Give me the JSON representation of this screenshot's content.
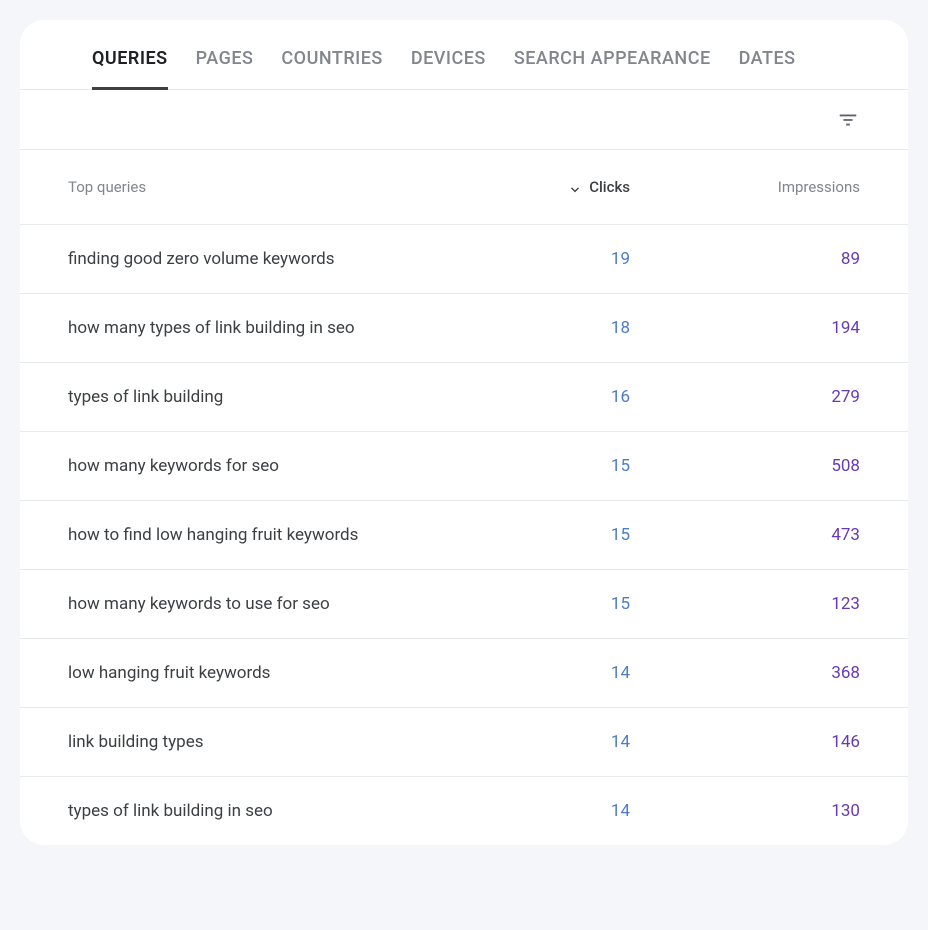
{
  "tabs": [
    {
      "label": "QUERIES",
      "active": true
    },
    {
      "label": "PAGES",
      "active": false
    },
    {
      "label": "COUNTRIES",
      "active": false
    },
    {
      "label": "DEVICES",
      "active": false
    },
    {
      "label": "SEARCH APPEARANCE",
      "active": false
    },
    {
      "label": "DATES",
      "active": false
    }
  ],
  "columns": {
    "query": "Top queries",
    "clicks": "Clicks",
    "impressions": "Impressions"
  },
  "sort": {
    "column": "clicks",
    "direction": "desc"
  },
  "rows": [
    {
      "query": "finding good zero volume keywords",
      "clicks": 19,
      "impressions": 89
    },
    {
      "query": "how many types of link building in seo",
      "clicks": 18,
      "impressions": 194
    },
    {
      "query": "types of link building",
      "clicks": 16,
      "impressions": 279
    },
    {
      "query": "how many keywords for seo",
      "clicks": 15,
      "impressions": 508
    },
    {
      "query": "how to find low hanging fruit keywords",
      "clicks": 15,
      "impressions": 473
    },
    {
      "query": "how many keywords to use for seo",
      "clicks": 15,
      "impressions": 123
    },
    {
      "query": "low hanging fruit keywords",
      "clicks": 14,
      "impressions": 368
    },
    {
      "query": "link building types",
      "clicks": 14,
      "impressions": 146
    },
    {
      "query": "types of link building in seo",
      "clicks": 14,
      "impressions": 130
    }
  ]
}
